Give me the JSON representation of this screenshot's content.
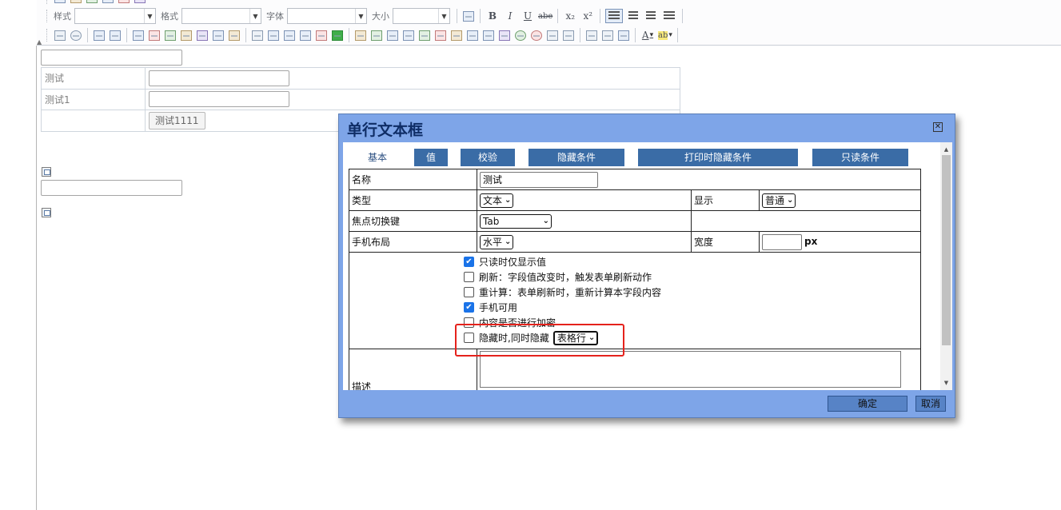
{
  "toolbar": {
    "style_label": "样式",
    "format_label": "格式",
    "font_label": "字体",
    "size_label": "大小",
    "bold": "B",
    "italic": "I",
    "underline": "U",
    "strike": "abe",
    "subscript": "x₂",
    "superscript": "x²",
    "font_color": "A",
    "highlight": "ab"
  },
  "form": {
    "row1_label": "测试",
    "row2_label": "测试1",
    "button_label": "测试1111"
  },
  "dialog": {
    "title": "单行文本框",
    "close": "☒",
    "tabs": [
      "基本",
      "值",
      "校验",
      "隐藏条件",
      "打印时隐藏条件",
      "只读条件"
    ],
    "fields": {
      "name_label": "名称",
      "name_value": "测试",
      "type_label": "类型",
      "type_value": "文本",
      "display_label": "显示",
      "display_value": "普通",
      "focus_label": "焦点切换键",
      "focus_value": "Tab",
      "mobile_layout_label": "手机布局",
      "mobile_layout_value": "水平",
      "width_label": "宽度",
      "width_unit": "px",
      "desc_label": "描述"
    },
    "options": [
      {
        "label": "只读时仅显示值",
        "checked": true
      },
      {
        "label": "刷新：字段值改变时，触发表单刷新动作",
        "checked": false
      },
      {
        "label": "重计算：表单刷新时，重新计算本字段内容",
        "checked": false
      },
      {
        "label": "手机可用",
        "checked": true
      },
      {
        "label": "内容是否进行加密",
        "checked": false
      }
    ],
    "hide_option": {
      "label": "隐藏时,同时隐藏",
      "checked": false,
      "select_value": "表格行"
    },
    "ok_label": "确定",
    "cancel_label": "取消"
  },
  "colors": {
    "dialog_frame": "#7ea5e8",
    "tab_blue": "#3a6ca6",
    "title_text": "#0f2d66",
    "highlight": "#e5221c",
    "checkbox_on": "#1a73e8"
  }
}
